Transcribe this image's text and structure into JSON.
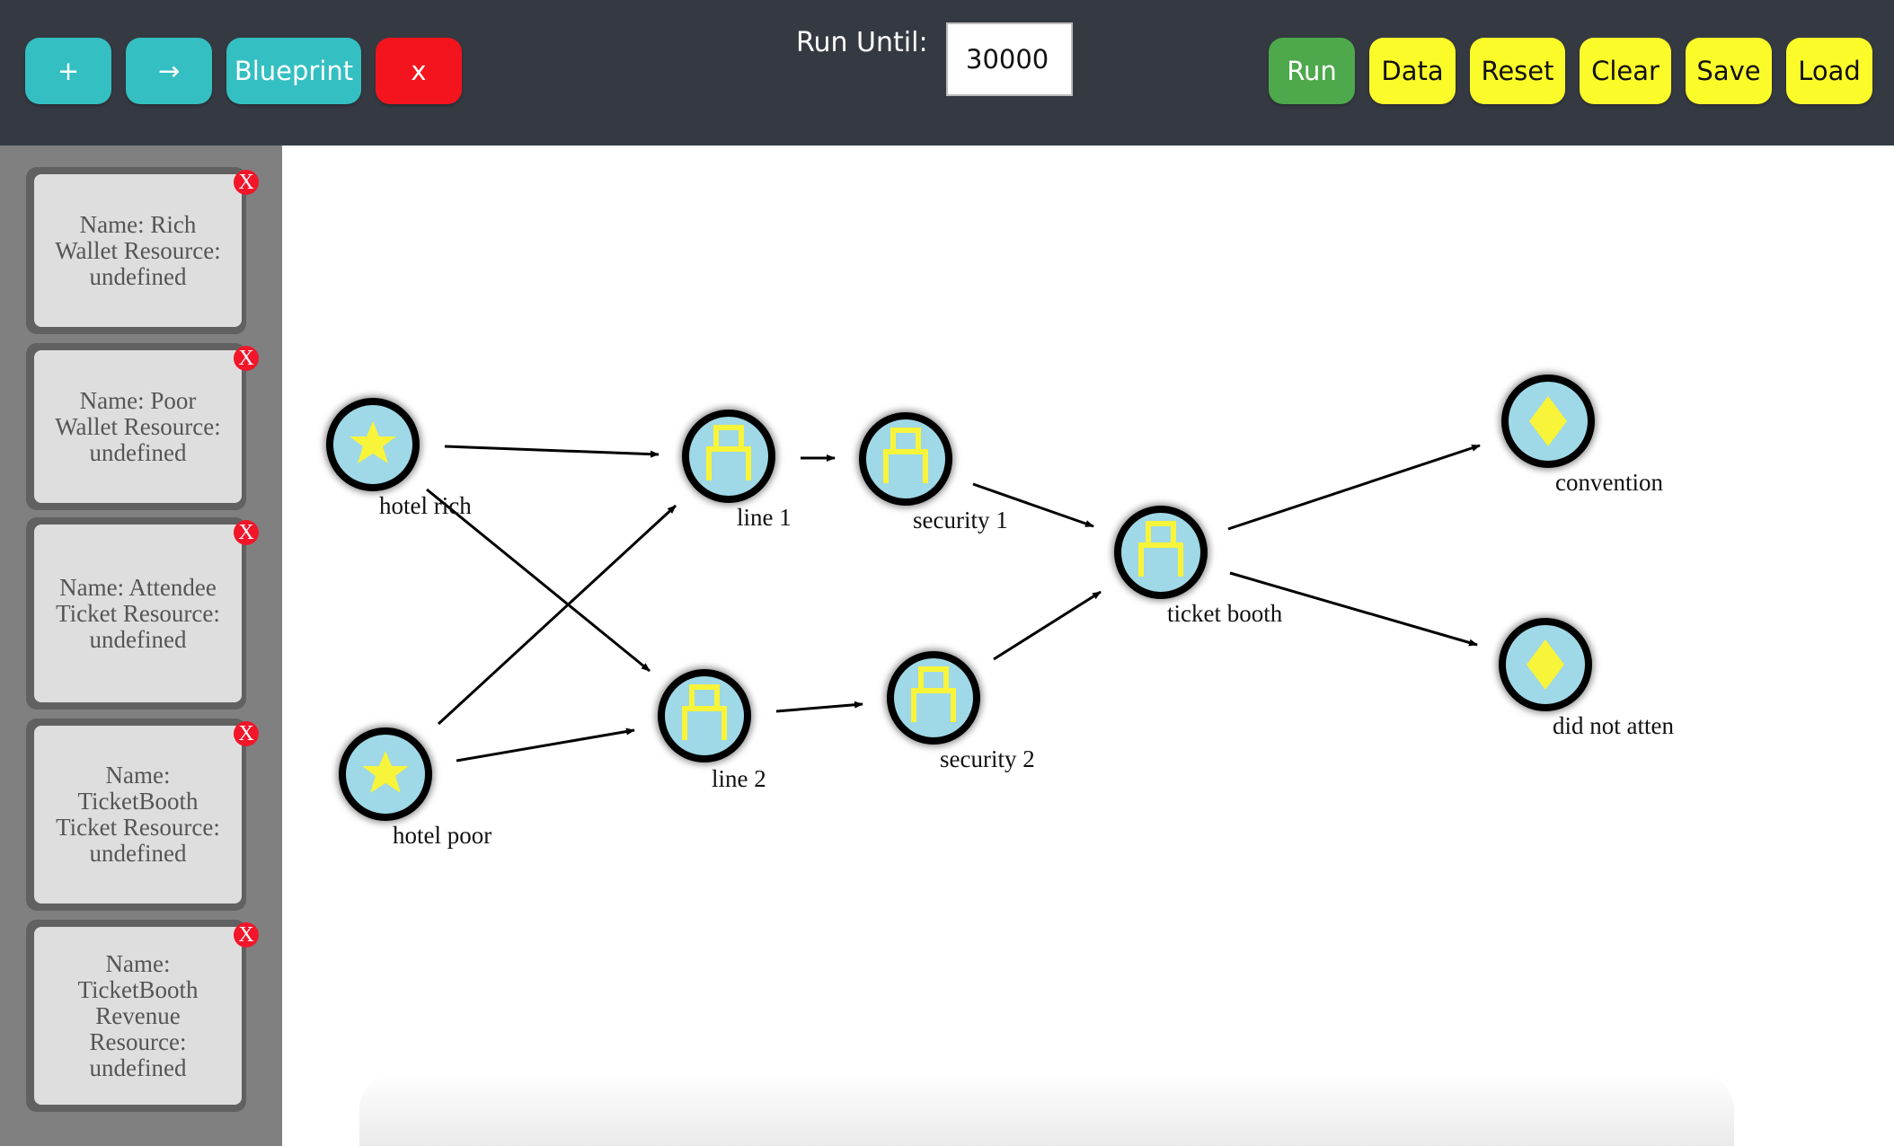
{
  "toolbar": {
    "add_label": "+",
    "arrow_label": "→",
    "blueprint_label": "Blueprint",
    "delete_label": "x",
    "run_until_label": "Run Until:",
    "run_until_value": "30000",
    "run_label": "Run",
    "data_label": "Data",
    "reset_label": "Reset",
    "clear_label": "Clear",
    "save_label": "Save",
    "load_label": "Load"
  },
  "sidebar": {
    "close_label": "X",
    "cards": [
      {
        "text": "Name: Rich Wallet Resource: undefined"
      },
      {
        "text": "Name: Poor Wallet Resource: undefined"
      },
      {
        "text": "Name: Attendee Ticket Resource: undefined"
      },
      {
        "text": "Name: TicketBooth Ticket Resource: undefined"
      },
      {
        "text": "Name: TicketBooth Revenue Resource: undefined"
      }
    ]
  },
  "diagram": {
    "nodes": [
      {
        "id": "hotel-rich",
        "label": "hotel rich",
        "type": "source",
        "icon": "star-icon"
      },
      {
        "id": "hotel-poor",
        "label": "hotel poor",
        "type": "source",
        "icon": "star-icon"
      },
      {
        "id": "line-1",
        "label": "line 1",
        "type": "queue",
        "icon": "lock-icon"
      },
      {
        "id": "line-2",
        "label": "line 2",
        "type": "queue",
        "icon": "lock-icon"
      },
      {
        "id": "security-1",
        "label": "security 1",
        "type": "queue",
        "icon": "lock-icon"
      },
      {
        "id": "security-2",
        "label": "security 2",
        "type": "queue",
        "icon": "lock-icon"
      },
      {
        "id": "ticket-booth",
        "label": "ticket booth",
        "type": "queue",
        "icon": "lock-icon"
      },
      {
        "id": "convention",
        "label": "convention",
        "type": "sink",
        "icon": "diamond-icon"
      },
      {
        "id": "did-not-attend",
        "label": "did not atten",
        "type": "sink",
        "icon": "diamond-icon"
      }
    ],
    "edges": [
      {
        "from": "hotel-rich",
        "to": "line-1"
      },
      {
        "from": "hotel-rich",
        "to": "line-2"
      },
      {
        "from": "hotel-poor",
        "to": "line-1"
      },
      {
        "from": "hotel-poor",
        "to": "line-2"
      },
      {
        "from": "line-1",
        "to": "security-1"
      },
      {
        "from": "line-2",
        "to": "security-2"
      },
      {
        "from": "security-1",
        "to": "ticket-booth"
      },
      {
        "from": "security-2",
        "to": "ticket-booth"
      },
      {
        "from": "ticket-booth",
        "to": "convention"
      },
      {
        "from": "ticket-booth",
        "to": "did-not-attend"
      }
    ]
  },
  "colors": {
    "toolbar_bg": "#353a42",
    "teal": "#34bfc2",
    "red": "#f3141e",
    "green": "#4ea84c",
    "yellow": "#fbfb2a",
    "node_fill": "#9fd8e6",
    "icon_yellow": "#f8f43a"
  }
}
